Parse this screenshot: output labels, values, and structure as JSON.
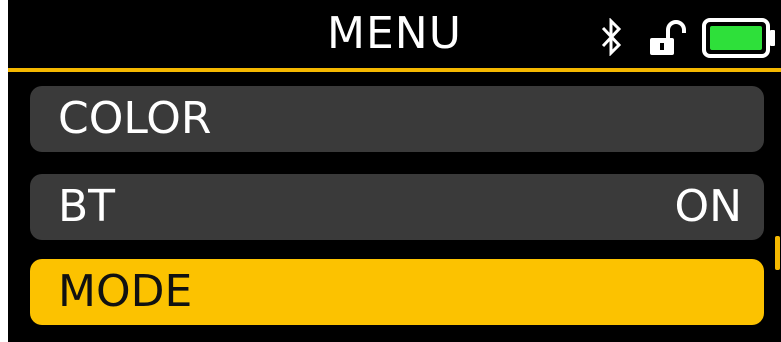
{
  "header": {
    "title": "MENU",
    "icons": [
      "bluetooth-icon",
      "unlocked-padlock-icon",
      "battery-icon"
    ],
    "battery_level": 1.0
  },
  "menu": {
    "items": [
      {
        "label": "COLOR",
        "value": "",
        "selected": false
      },
      {
        "label": "BT",
        "value": "ON",
        "selected": false
      },
      {
        "label": "MODE",
        "value": "",
        "selected": true
      }
    ]
  },
  "colors": {
    "background": "#000000",
    "item_background": "#3a3a3a",
    "accent": "#fcc200",
    "battery_fill": "#2ee03a",
    "text": "#ffffff"
  }
}
